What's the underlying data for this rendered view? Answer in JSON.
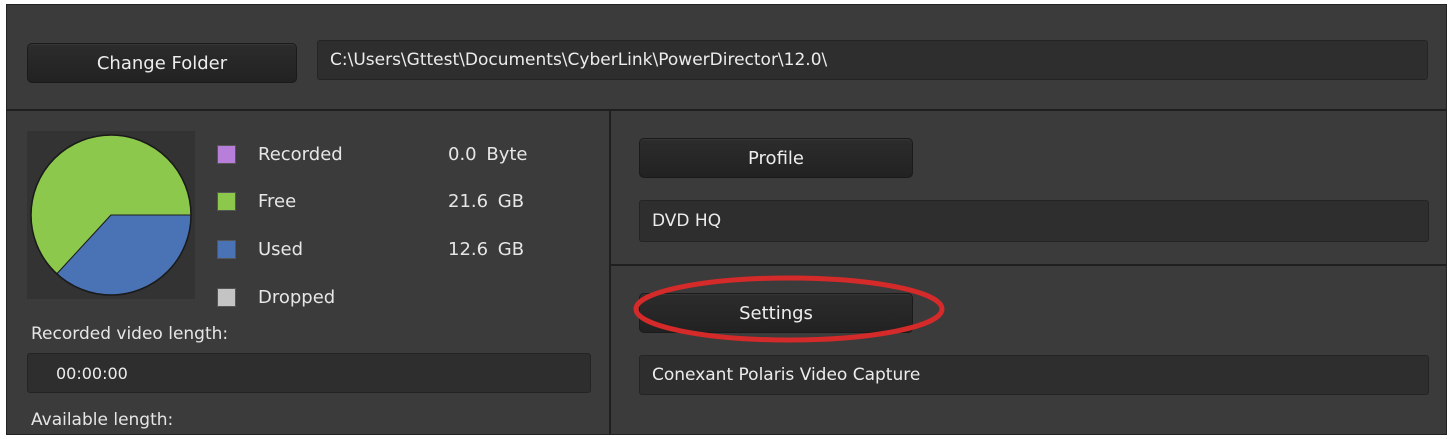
{
  "toolbar": {
    "change_folder_label": "Change Folder",
    "folder_path": "C:\\Users\\Gttest\\Documents\\CyberLink\\PowerDirector\\12.0\\"
  },
  "storage": {
    "chart_data": {
      "type": "pie",
      "categories": [
        "Recorded",
        "Free",
        "Used",
        "Dropped"
      ],
      "values": [
        0.0,
        21.6,
        12.6,
        0.0
      ],
      "units": [
        "Byte",
        "GB",
        "GB",
        ""
      ],
      "colors": [
        "#b77fd9",
        "#8cc84b",
        "#4a73b5",
        "#c4c4c4"
      ]
    },
    "legend": [
      {
        "label": "Recorded",
        "value": "0.0 Byte",
        "color": "#b77fd9"
      },
      {
        "label": "Free",
        "value": "21.6 GB",
        "color": "#8cc84b"
      },
      {
        "label": "Used",
        "value": "12.6 GB",
        "color": "#4a73b5"
      },
      {
        "label": "Dropped",
        "value": "",
        "color": "#c4c4c4"
      }
    ],
    "recorded_length_label": "Recorded video length:",
    "recorded_length_value": "00:00:00",
    "available_length_label": "Available length:"
  },
  "profile": {
    "button_label": "Profile",
    "value": "DVD HQ"
  },
  "settings": {
    "button_label": "Settings",
    "device": "Conexant Polaris Video Capture"
  },
  "annotation": {
    "highlight_color": "#d42a2a"
  }
}
